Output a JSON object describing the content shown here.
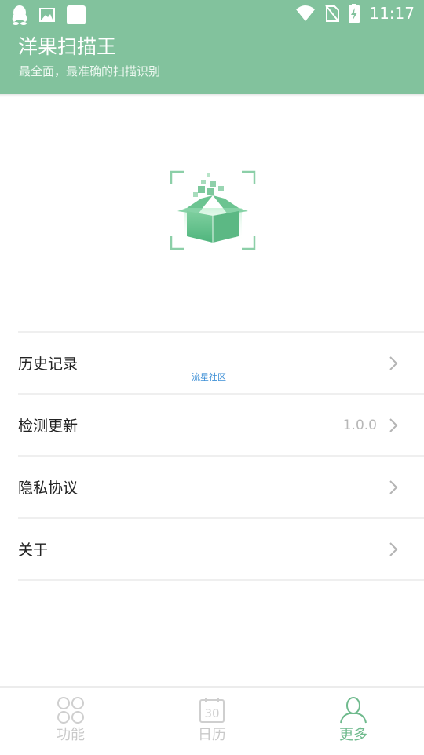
{
  "status_bar": {
    "time": "11:17"
  },
  "header": {
    "title": "洋果扫描王",
    "subtitle": "最全面，最准确的扫描识别"
  },
  "menu": {
    "items": [
      {
        "label": "历史记录",
        "value": ""
      },
      {
        "label": "检测更新",
        "value": "1.0.0"
      },
      {
        "label": "隐私协议",
        "value": ""
      },
      {
        "label": "关于",
        "value": ""
      }
    ]
  },
  "watermark": "流星社区",
  "bottom_nav": {
    "items": [
      {
        "label": "功能",
        "icon": "grid-icon",
        "active": false
      },
      {
        "label": "日历",
        "icon": "calendar-icon",
        "active": false
      },
      {
        "label": "更多",
        "icon": "user-icon",
        "active": true
      }
    ]
  },
  "colors": {
    "header": "#82c29d",
    "accent": "#6fba8d",
    "inactive": "#c9c9c9"
  }
}
